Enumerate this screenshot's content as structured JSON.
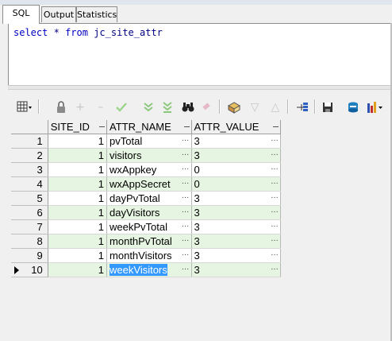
{
  "tabs": [
    {
      "label": "SQL",
      "active": true
    },
    {
      "label": "Output",
      "active": false
    },
    {
      "label": "Statistics",
      "active": false
    }
  ],
  "editor": {
    "keyword1": "select",
    "star": "*",
    "keyword2": "from",
    "table": "jc_site_attr"
  },
  "toolbar": {
    "icons": [
      "grid-menu-icon",
      "lock-icon",
      "insert-record-icon",
      "delete-record-icon",
      "post-changes-icon",
      "next-record-icon",
      "last-record-icon",
      "find-icon",
      "clear-icon",
      "query-by-example-icon",
      "sort-ascending-icon",
      "sort-descending-icon",
      "connection-tree-icon",
      "save-icon",
      "export-icon",
      "chart-icon"
    ]
  },
  "grid": {
    "columns": [
      "SITE_ID",
      "ATTR_NAME",
      "ATTR_VALUE"
    ],
    "rows": [
      {
        "n": "1",
        "site_id": "1",
        "name": "pvTotal",
        "value": "3"
      },
      {
        "n": "2",
        "site_id": "1",
        "name": "visitors",
        "value": "3"
      },
      {
        "n": "3",
        "site_id": "1",
        "name": "wxAppkey",
        "value": "0"
      },
      {
        "n": "4",
        "site_id": "1",
        "name": "wxAppSecret",
        "value": "0"
      },
      {
        "n": "5",
        "site_id": "1",
        "name": "dayPvTotal",
        "value": "3"
      },
      {
        "n": "6",
        "site_id": "1",
        "name": "dayVisitors",
        "value": "3"
      },
      {
        "n": "7",
        "site_id": "1",
        "name": "weekPvTotal",
        "value": "3"
      },
      {
        "n": "8",
        "site_id": "1",
        "name": "monthPvTotal",
        "value": "3"
      },
      {
        "n": "9",
        "site_id": "1",
        "name": "monthVisitors",
        "value": "3"
      },
      {
        "n": "10",
        "site_id": "1",
        "name": "weekVisitors",
        "value": "3"
      }
    ]
  }
}
